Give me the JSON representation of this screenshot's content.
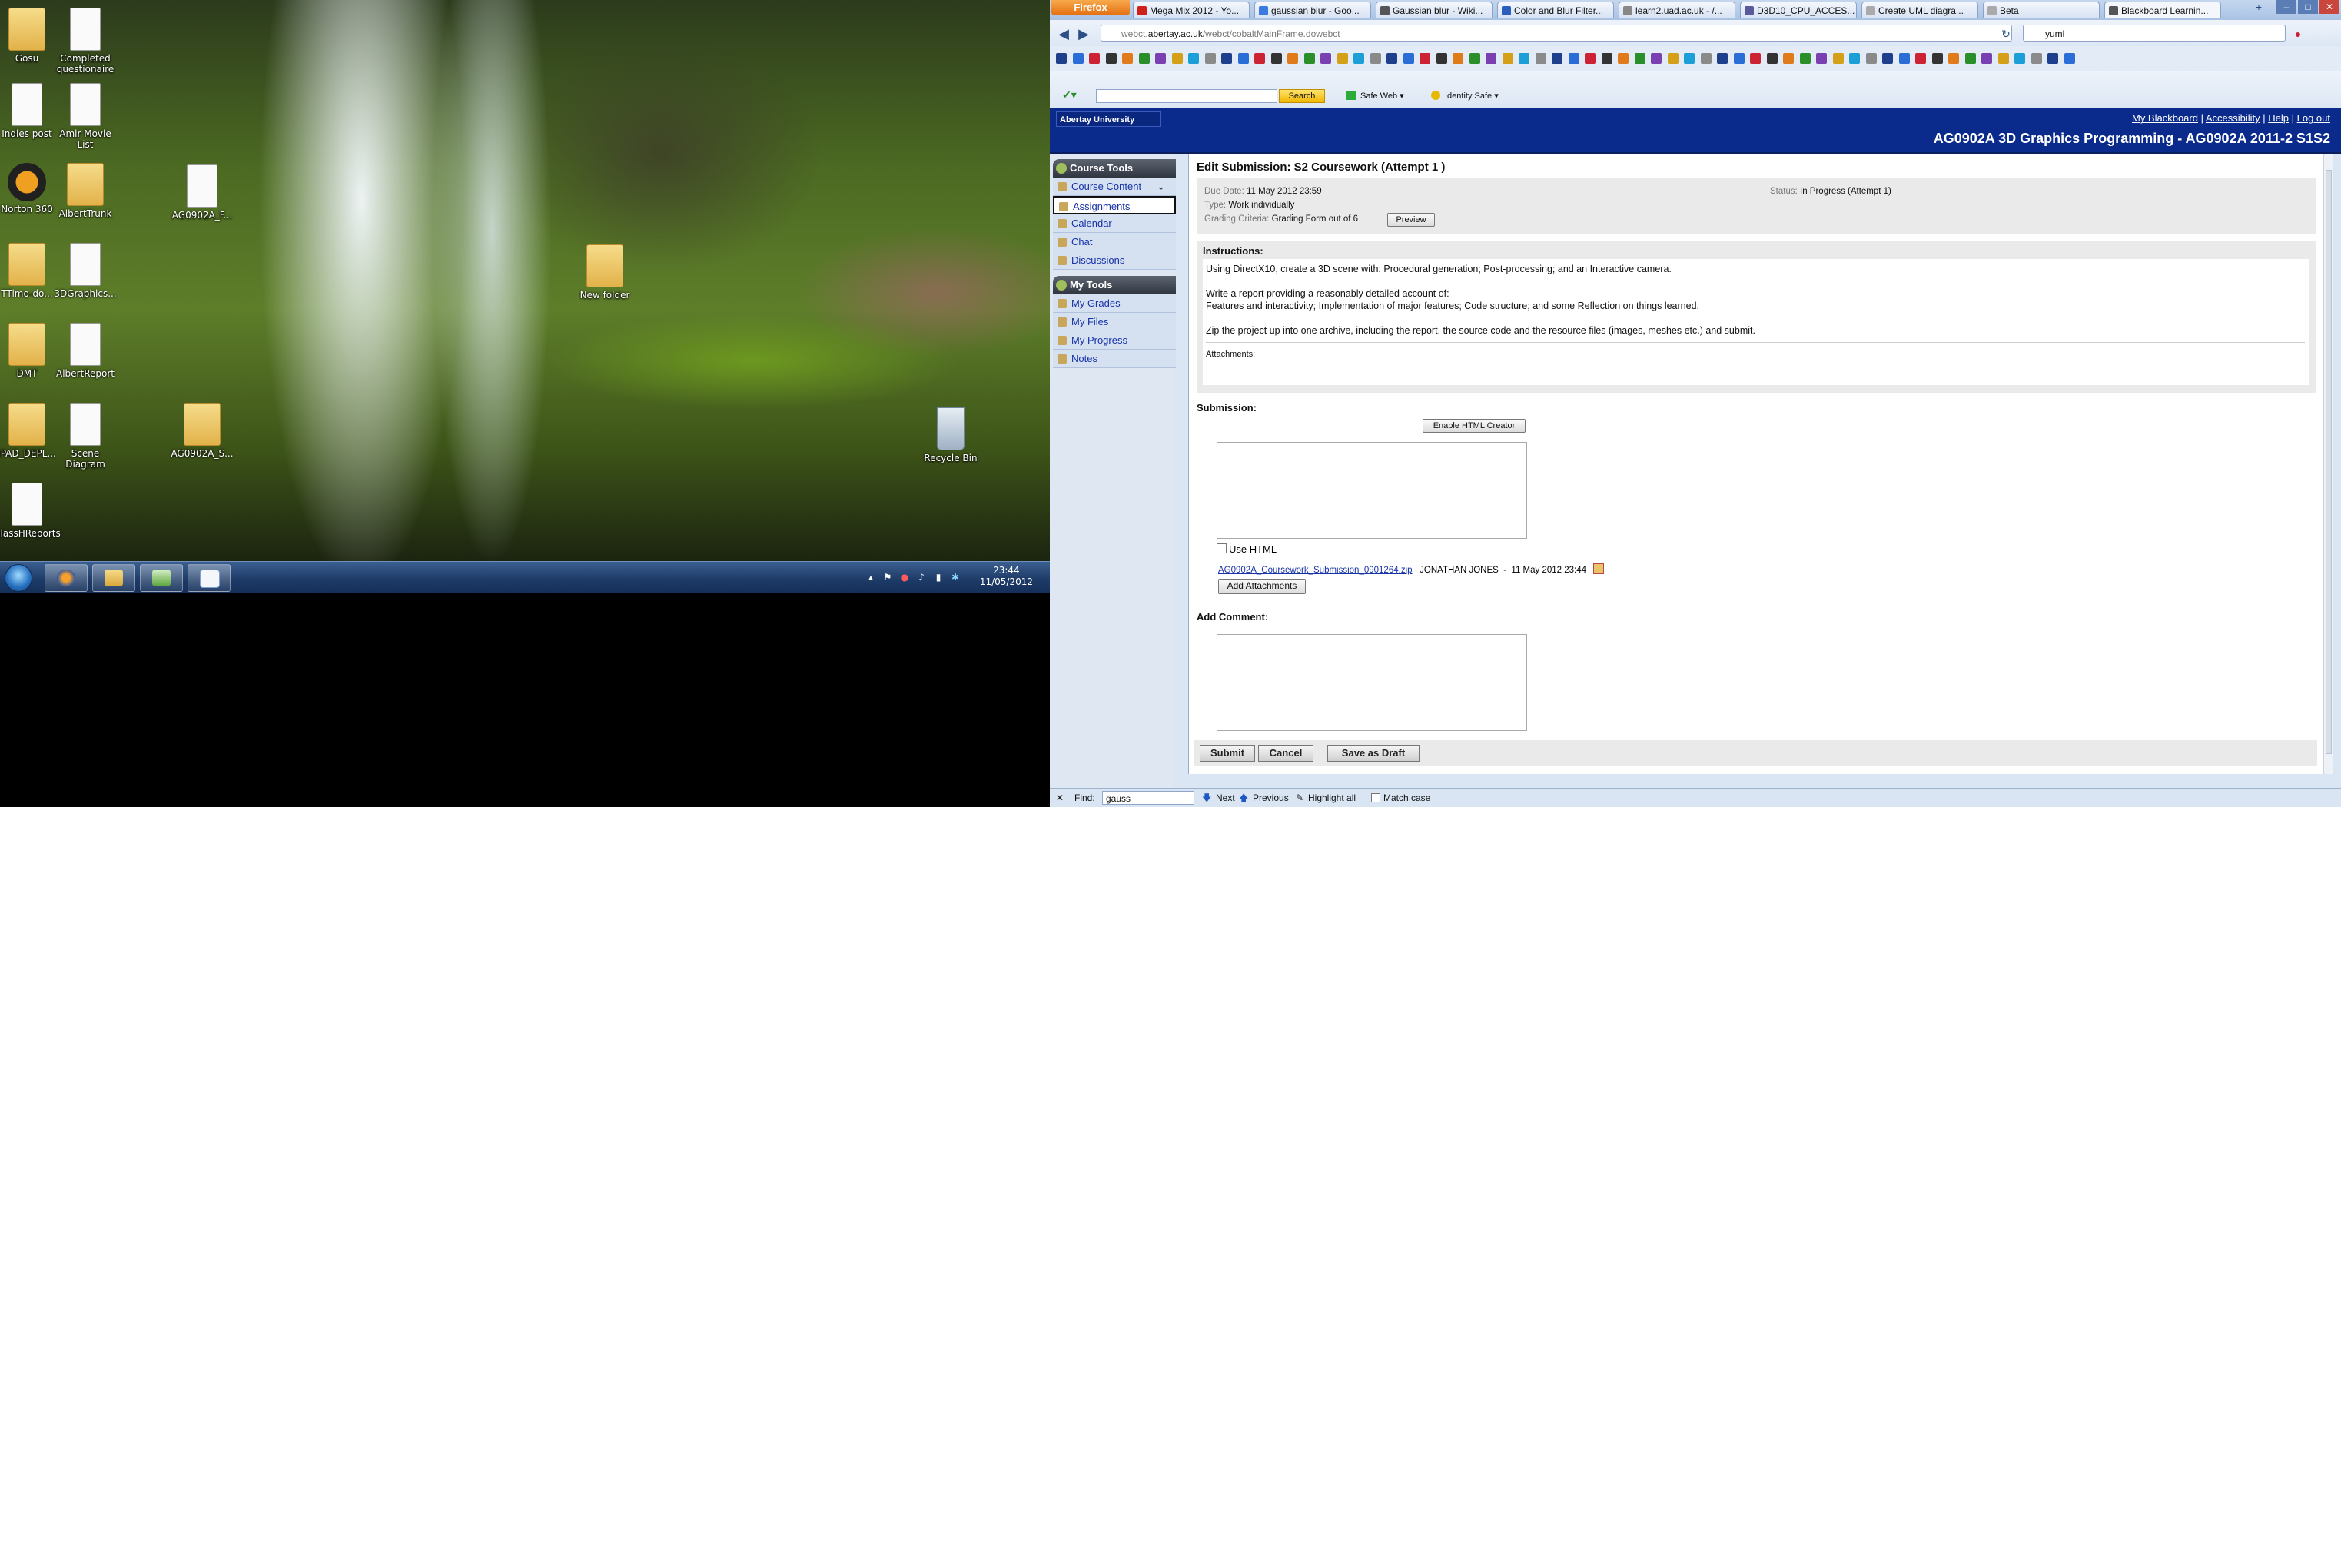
{
  "desktop": {
    "icons": [
      {
        "label": "Gosu"
      },
      {
        "label": "Completed questionaire"
      },
      {
        "label": "Indies post"
      },
      {
        "label": "Amir Movie List"
      },
      {
        "label": "Norton 360"
      },
      {
        "label": "AlbertTrunk"
      },
      {
        "label": "AG0902A_F..."
      },
      {
        "label": "TTimo-do..."
      },
      {
        "label": "3DGraphics..."
      },
      {
        "label": "New folder"
      },
      {
        "label": "DMT"
      },
      {
        "label": "AlbertReport"
      },
      {
        "label": "IPAD_DEPL..."
      },
      {
        "label": "Scene Diagram"
      },
      {
        "label": "AG0902A_S..."
      },
      {
        "label": "Recycle Bin"
      },
      {
        "label": "GlassHReports"
      }
    ],
    "clock": {
      "time": "23:44",
      "date": "11/05/2012"
    }
  },
  "browser": {
    "app_button": "Firefox",
    "tabs": [
      {
        "label": "Mega Mix 2012 - Yo...",
        "icon": "youtube-icon",
        "color": "#d0201a"
      },
      {
        "label": "gaussian blur - Goo...",
        "icon": "google-icon",
        "color": "#3b7be0"
      },
      {
        "label": "Gaussian blur - Wiki...",
        "icon": "wikipedia-icon",
        "color": "#555555"
      },
      {
        "label": "Color and Blur Filter...",
        "icon": "blogger-icon",
        "color": "#2b5fbf"
      },
      {
        "label": "learn2.uad.ac.uk - /...",
        "icon": "page-icon",
        "color": "#888888"
      },
      {
        "label": "D3D10_CPU_ACCES...",
        "icon": "msdn-icon",
        "color": "#5a5a9a"
      },
      {
        "label": "Create UML diagra...",
        "icon": "page-icon",
        "color": "#aaaaaa"
      },
      {
        "label": "Beta",
        "icon": "page-icon",
        "color": "#aaaaaa"
      },
      {
        "label": "Blackboard Learnin...",
        "icon": "blackboard-icon",
        "color": "#555555"
      }
    ],
    "url_prefix": "webct.",
    "url_host": "abertay.ac.uk",
    "url_path": "/webct/cobaltMainFrame.dowebct",
    "search_value": "yuml",
    "norton": {
      "search_button": "Search",
      "safe_web": "Safe Web ▾",
      "identity_safe": "Identity Safe ▾"
    }
  },
  "blackboard": {
    "logo": "Abertay University",
    "links": [
      "My Blackboard",
      "Accessibility",
      "Help",
      "Log out"
    ],
    "course_title": "AG0902A 3D Graphics Programming - AG0902A 2011-2 S1S2",
    "sidebar": {
      "course_tools_title": "Course Tools",
      "course_tools": [
        "Course Content",
        "Assignments",
        "Calendar",
        "Chat",
        "Discussions"
      ],
      "my_tools_title": "My Tools",
      "my_tools": [
        "My Grades",
        "My Files",
        "My Progress",
        "Notes"
      ]
    },
    "page_title": "Edit Submission: S2 Coursework (Attempt 1 )",
    "meta": {
      "due_date_label": "Due Date:",
      "due_date": "11 May 2012 23:59",
      "type_label": "Type:",
      "type": "Work individually",
      "grading_label": "Grading Criteria:",
      "grading": "Grading Form out of 6",
      "preview_button": "Preview",
      "status_label": "Status:",
      "status": "In Progress (Attempt 1)"
    },
    "instructions": {
      "heading": "Instructions:",
      "lines": [
        "Using DirectX10, create a 3D scene with: Procedural generation; Post-processing; and an Interactive camera.",
        "Write a report providing a reasonably detailed account of:",
        "Features and interactivity; Implementation of major features; Code structure; and some Reflection on things learned.",
        "Zip the project up into one archive, including the report, the source code and the resource files (images, meshes etc.) and submit."
      ],
      "attachments_label": "Attachments:"
    },
    "submission": {
      "heading": "Submission:",
      "enable_html_button": "Enable HTML Creator",
      "use_html_label": "Use HTML",
      "file_name": "AG0902A_Coursework_Submission_0901264.zip",
      "file_owner": "JONATHAN JONES",
      "file_sep": "-",
      "file_date": "11 May 2012 23:44",
      "add_attachments_button": "Add Attachments"
    },
    "comment": {
      "heading": "Add Comment:"
    },
    "buttons": {
      "submit": "Submit",
      "cancel": "Cancel",
      "save_draft": "Save as Draft"
    }
  },
  "findbar": {
    "label": "Find:",
    "value": "gauss",
    "next": "Next",
    "previous": "Previous",
    "highlight": "Highlight all",
    "match_case": "Match case"
  }
}
